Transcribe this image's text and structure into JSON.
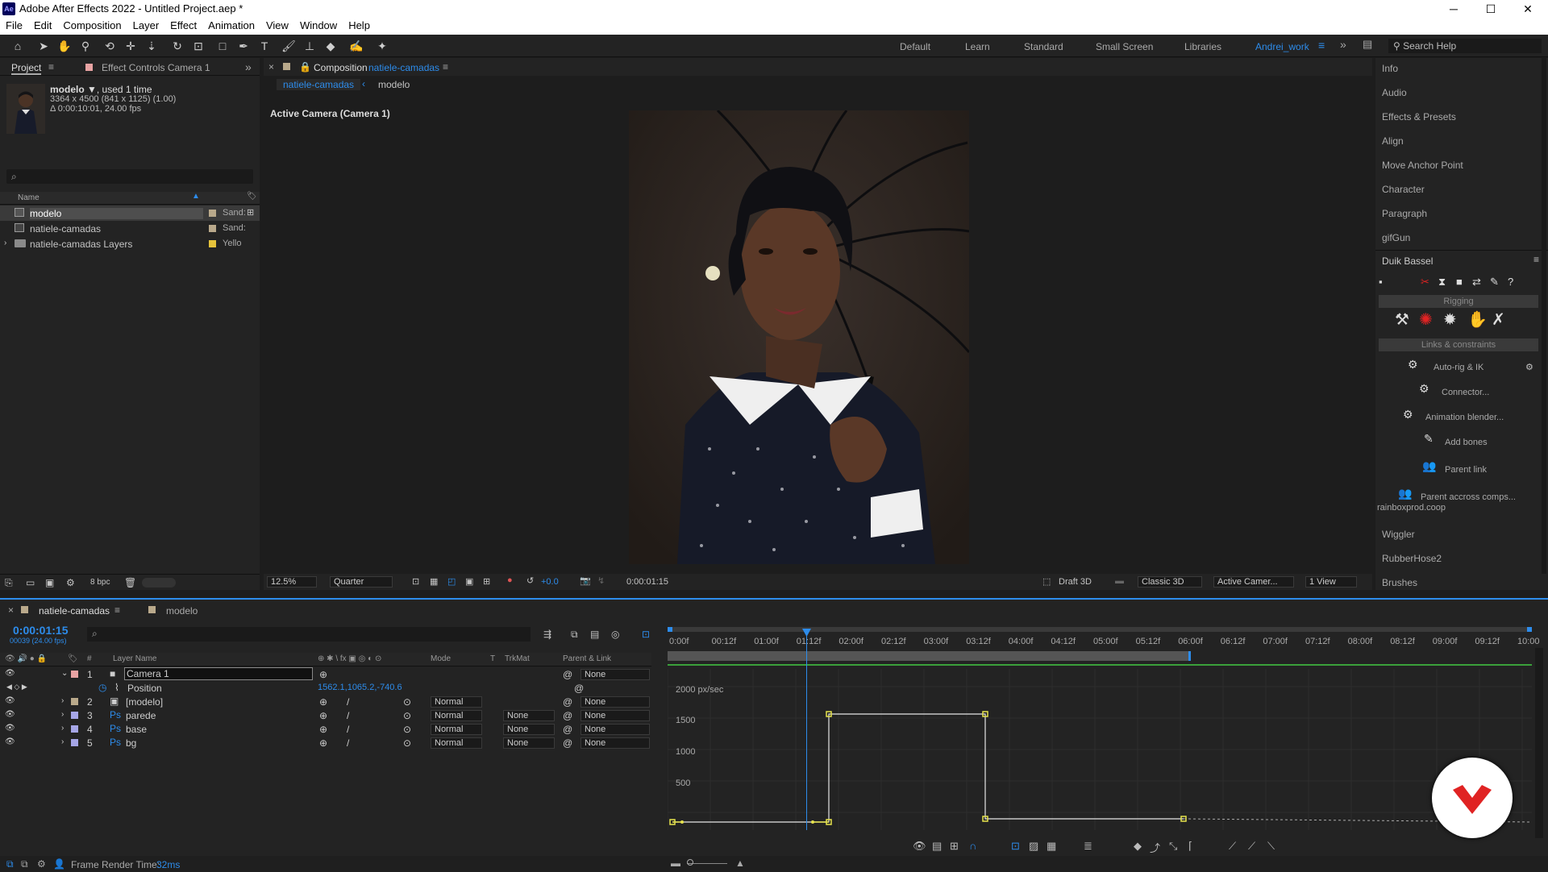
{
  "app": {
    "logo": "Ae",
    "title": "Adobe After Effects 2022 - Untitled Project.aep *"
  },
  "window_controls": {
    "minimize": "─",
    "maximize": "☐",
    "close": "✕"
  },
  "menu": [
    "File",
    "Edit",
    "Composition",
    "Layer",
    "Effect",
    "Animation",
    "View",
    "Window",
    "Help"
  ],
  "workspaces": [
    "Default",
    "Learn",
    "Standard",
    "Small Screen",
    "Libraries",
    "Andrei_work"
  ],
  "search_help": "Search Help",
  "project": {
    "tab": "Project",
    "effect_controls_tab": "Effect Controls Camera 1",
    "item_name": "modelo ▼",
    "item_used": ", used 1 time",
    "item_dims": "3364 x 4500  (841 x 1125) (1.00)",
    "item_duration": "Δ 0:00:10:01, 24.00 fps",
    "search_placeholder": "⌕",
    "col_name": "Name",
    "items": [
      {
        "name": "modelo",
        "label": "Sand:",
        "color": "#b9a98b",
        "selected": true
      },
      {
        "name": "natiele-camadas",
        "label": "Sand:",
        "color": "#b9a98b"
      },
      {
        "name": "natiele-camadas Layers",
        "label": "Yello",
        "color": "#e6c33b"
      }
    ],
    "bpc": "8 bpc"
  },
  "composition": {
    "tab_prefix": "Composition",
    "tab_name": "natiele-camadas",
    "breadcrumb": [
      "natiele-camadas",
      "modelo"
    ],
    "camera_label": "Active Camera (Camera 1)",
    "zoom": "12.5%",
    "resolution": "Quarter",
    "exposure": "+0.0",
    "timecode": "0:00:01:15",
    "draft3d": "Draft 3D",
    "renderer": "Classic 3D",
    "view": "Active Camer...",
    "views": "1 View"
  },
  "right_panel": {
    "items_top": [
      "Info",
      "Audio",
      "Effects & Presets",
      "Align",
      "Move Anchor Point",
      "Character",
      "Paragraph",
      "gifGun"
    ],
    "duik_title": "Duik Bassel",
    "rigging": "Rigging",
    "links": "Links & constraints",
    "duik_items": [
      "Auto-rig & IK",
      "Connector...",
      "Animation blender...",
      "Add bones",
      "Parent link",
      "Parent accross comps..."
    ],
    "credit": "rainboxprod.coop",
    "items_bottom": [
      "Wiggler",
      "RubberHose2",
      "Brushes"
    ]
  },
  "timeline": {
    "tab": "natiele-camadas",
    "tab2": "modelo",
    "timecode": "0:00:01:15",
    "frame_info": "00039 (24.00 fps)",
    "col_layer_name": "Layer Name",
    "col_mode": "Mode",
    "col_t": "T",
    "col_trkmat": "TrkMat",
    "col_parent": "Parent & Link",
    "layers": [
      {
        "num": "1",
        "name": "Camera 1",
        "mode": "",
        "trkmat": "",
        "parent": "None",
        "color": "#e8a3a3"
      },
      {
        "num": "2",
        "name": "[modelo]",
        "mode": "Normal",
        "trkmat": "",
        "parent": "None",
        "color": "#b9a98b"
      },
      {
        "num": "3",
        "name": "parede",
        "mode": "Normal",
        "trkmat": "None",
        "parent": "None",
        "color": "#a6a6e6"
      },
      {
        "num": "4",
        "name": "base",
        "mode": "Normal",
        "trkmat": "None",
        "parent": "None",
        "color": "#a6a6e6"
      },
      {
        "num": "5",
        "name": "bg",
        "mode": "Normal",
        "trkmat": "None",
        "parent": "None",
        "color": "#a6a6e6"
      }
    ],
    "position_label": "Position",
    "position_value": "1562.1,1065.2,-740.6",
    "ruler": [
      "0:00f",
      "00:12f",
      "01:00f",
      "01:12f",
      "02:00f",
      "02:12f",
      "03:00f",
      "03:12f",
      "04:00f",
      "04:12f",
      "05:00f",
      "05:12f",
      "06:00f",
      "06:12f",
      "07:00f",
      "07:12f",
      "08:00f",
      "08:12f",
      "09:00f",
      "09:12f",
      "10:00"
    ],
    "graph_labels": [
      "2000 px/sec",
      "1500",
      "1000",
      "500"
    ],
    "frame_render_label": "Frame Render Time:",
    "frame_render_value": "32ms"
  },
  "colors": {
    "accent": "#2d8ceb",
    "keyframe": "#e6e34d",
    "workarea": "#4a4a4a",
    "duik_red": "#e02323"
  }
}
